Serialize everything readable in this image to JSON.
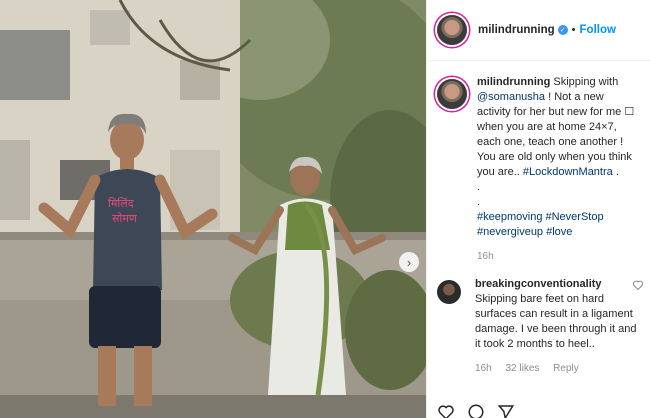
{
  "header": {
    "username": "milindrunning",
    "separator": "•",
    "follow_label": "Follow"
  },
  "caption": {
    "username": "milindrunning",
    "mention": "@somanusha",
    "part1": "Skipping with",
    "part2": "! Not a new activity for her but new for me",
    "emoji": "☐",
    "part3": "when you are at home 24×7, each one, teach one another ! You are old only when you think you are..",
    "hashtag1": "#LockdownMantra",
    "part3_end": ".",
    "dot_line1": ".",
    "dot_line2": ".",
    "tags": [
      "#keepmoving",
      "#NeverStop",
      "#nevergiveup",
      "#love"
    ],
    "time": "16h"
  },
  "comment": {
    "username": "breakingconventionality",
    "text": "Skipping bare feet on hard surfaces can result in a ligament damage. I ve been through it and it took 2 months to heel..",
    "time": "16h",
    "likes": "32 likes",
    "reply": "Reply"
  },
  "media": {
    "next_glyph": "›",
    "shirt_text_line1": "मिलिंद",
    "shirt_text_line2": "सोमण"
  },
  "icons": [
    "verified-badge-icon",
    "heart-icon",
    "chevron-right-icon",
    "like-icon",
    "comment-icon",
    "share-icon"
  ]
}
